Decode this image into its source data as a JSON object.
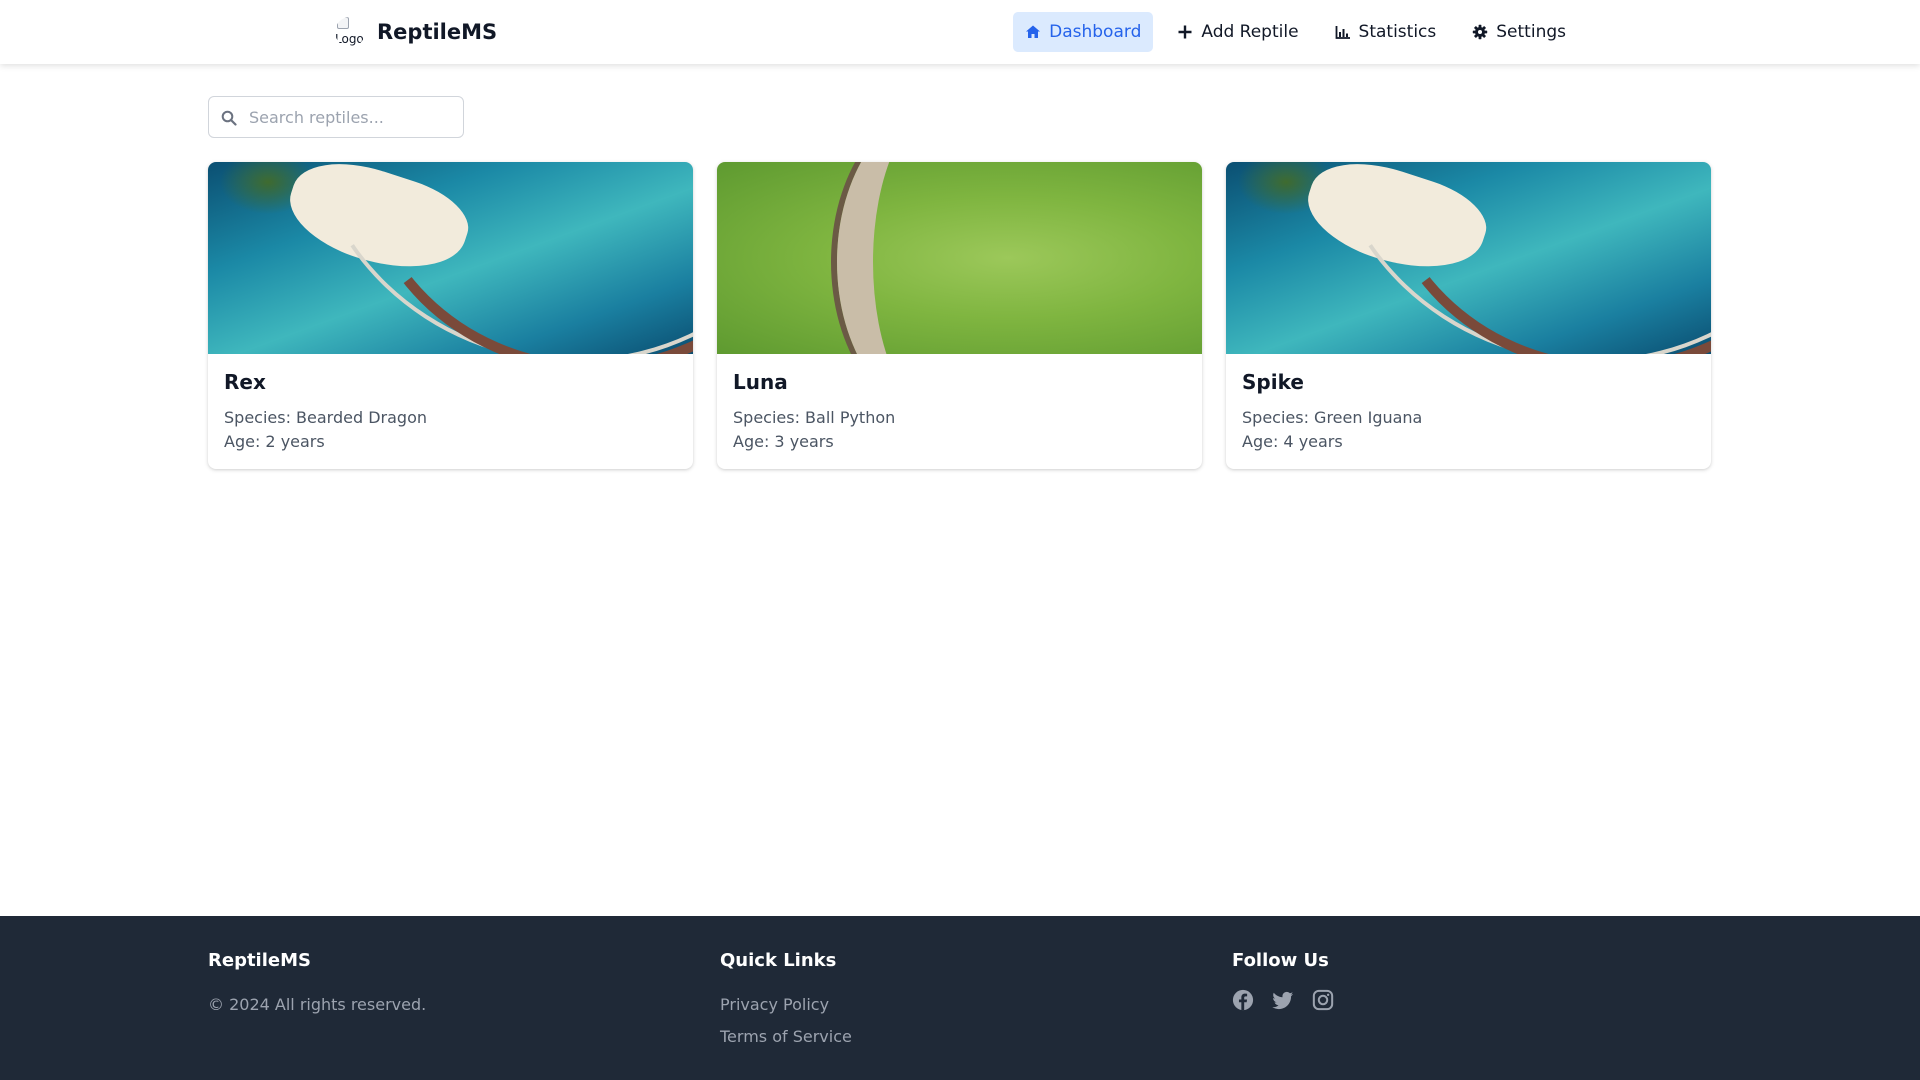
{
  "header": {
    "brand_name": "ReptileMS",
    "logo_alt": "Logo",
    "nav": [
      {
        "label": "Dashboard",
        "icon": "home-icon",
        "active": true
      },
      {
        "label": "Add Reptile",
        "icon": "plus-icon"
      },
      {
        "label": "Statistics",
        "icon": "bar-chart-icon"
      },
      {
        "label": "Settings",
        "icon": "gear-icon"
      }
    ]
  },
  "search": {
    "placeholder": "Search reptiles...",
    "value": ""
  },
  "reptiles": [
    {
      "name": "Rex",
      "species": "Species: Bearded Dragon",
      "age": "Age: 2 years",
      "image": "resort-aerial"
    },
    {
      "name": "Luna",
      "species": "Species: Ball Python",
      "age": "Age: 3 years",
      "image": "snake-closeup"
    },
    {
      "name": "Spike",
      "species": "Species: Green Iguana",
      "age": "Age: 4 years",
      "image": "resort-aerial"
    }
  ],
  "footer": {
    "brand": {
      "title": "ReptileMS",
      "copyright": "© 2024 All rights reserved."
    },
    "quick_links": {
      "title": "Quick Links",
      "links": [
        "Privacy Policy",
        "Terms of Service"
      ]
    },
    "follow": {
      "title": "Follow Us",
      "icons": [
        "facebook-icon",
        "twitter-icon",
        "instagram-icon"
      ]
    }
  },
  "colors": {
    "accent": "#2563eb",
    "accent_bg": "#dbeafe",
    "footer_bg": "#1f2937"
  }
}
